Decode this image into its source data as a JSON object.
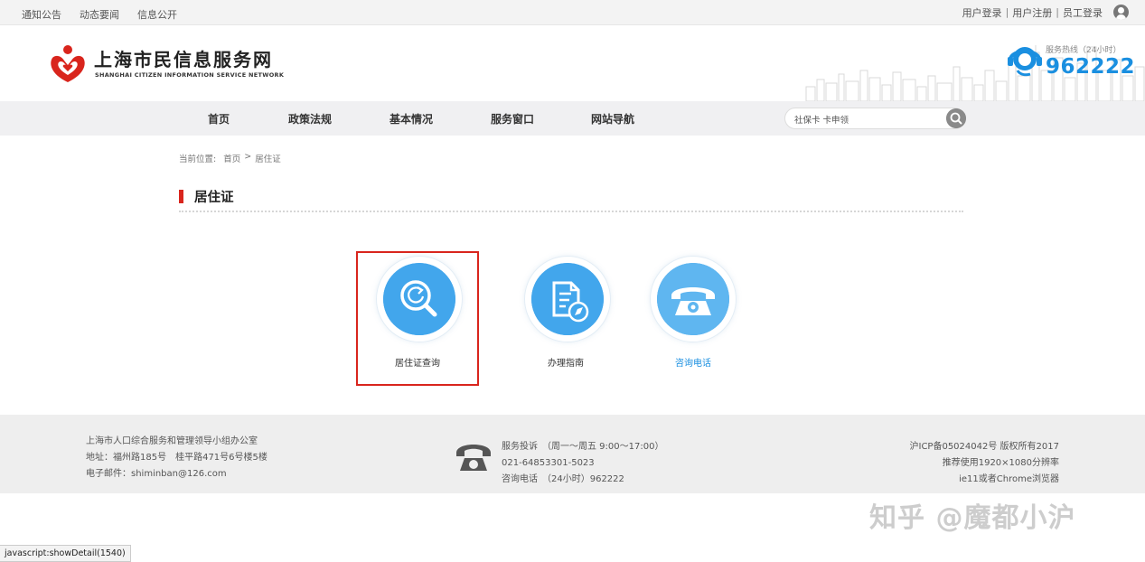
{
  "topbar": {
    "links": [
      "通知公告",
      "动态要闻",
      "信息公开"
    ],
    "login": "用户登录",
    "register": "用户注册",
    "staff_login": "员工登录",
    "separator": "|"
  },
  "header": {
    "title": "上海市民信息服务网",
    "subtitle": "SHANGHAI CITIZEN INFORMATION SERVICE NETWORK",
    "hotline_label": "服务热线（24小时）",
    "hotline_number": "962222"
  },
  "nav": {
    "items": [
      "首页",
      "政策法规",
      "基本情况",
      "服务窗口",
      "网站导航"
    ],
    "search_value": "社保卡 卡申领"
  },
  "breadcrumb": {
    "label": "当前位置:",
    "home": "首页",
    "sep": ">",
    "current": "居住证"
  },
  "section": {
    "title": "居住证"
  },
  "services": [
    {
      "label": "居住证查询",
      "icon": "search-refresh-icon"
    },
    {
      "label": "办理指南",
      "icon": "document-compass-icon"
    },
    {
      "label": "咨询电话",
      "icon": "telephone-icon"
    }
  ],
  "footer": {
    "org": "上海市人口综合服务和管理领导小组办公室",
    "address": "地址：福州路185号　桂平路471号6号楼5楼",
    "email": "电子邮件：shiminban@126.com",
    "complaint": "服务投诉　（周一～周五 9:00～17:00）",
    "complaint_phone": "021-64853301-5023",
    "consult": "咨询电话　（24小时）962222",
    "icp": "沪ICP备05024042号 版权所有2017",
    "resolution": "推荐使用1920×1080分辨率",
    "browser": "ie11或者Chrome浏览器"
  },
  "watermark": "知乎 @魔都小沪",
  "statusbar": "javascript:showDetail(1540)",
  "colors": {
    "accent_red": "#d9251d",
    "brand_blue": "#1a8fe0",
    "icon_blue": "#42a6ec"
  }
}
